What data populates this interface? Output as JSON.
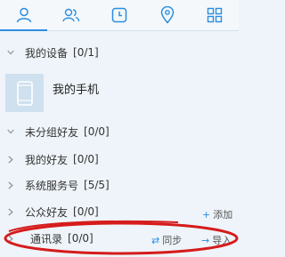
{
  "tabs": [
    {
      "icon": "person-icon"
    },
    {
      "icon": "contacts-icon"
    },
    {
      "icon": "clock-icon"
    },
    {
      "icon": "location-pin-icon"
    },
    {
      "icon": "grid-icon"
    }
  ],
  "sections": {
    "my_devices": {
      "label": "我的设备",
      "count": "[0/1]"
    },
    "device": {
      "name": "我的手机",
      "icon": "phone-icon"
    },
    "ungrouped": {
      "label": "未分组好友",
      "count": "[0/0]"
    },
    "my_friends": {
      "label": "我的好友",
      "count": "[0/0]"
    },
    "system": {
      "label": "系统服务号",
      "count": "[5/5]"
    },
    "public": {
      "label": "公众好友",
      "count": "[0/0]",
      "add_label": "添加"
    },
    "address_book": {
      "label": "通讯录",
      "count": "[0/0]",
      "sync_label": "同步",
      "import_label": "导入"
    }
  },
  "colors": {
    "accent": "#2b8de0",
    "annotation": "#d61b1b"
  }
}
